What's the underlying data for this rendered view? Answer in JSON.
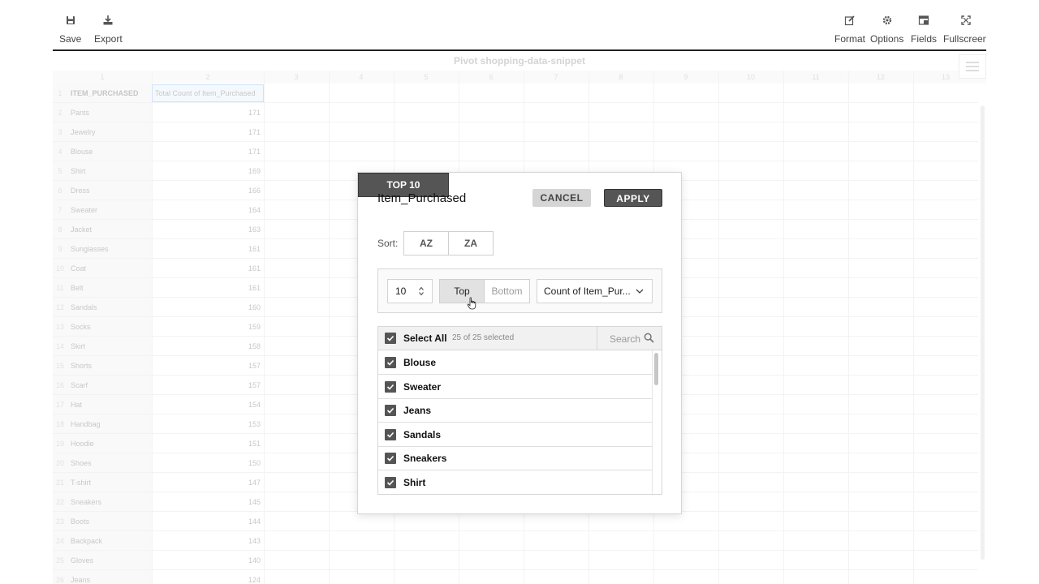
{
  "toolbar": {
    "save": "Save",
    "export": "Export",
    "format": "Format",
    "options": "Options",
    "fields": "Fields",
    "fullscreen": "Fullscreen"
  },
  "grid": {
    "title": "Pivot shopping-data-snippet",
    "column_numbers": [
      "1",
      "2",
      "3",
      "4",
      "5",
      "6",
      "7",
      "8",
      "9",
      "10",
      "11",
      "12",
      "13"
    ],
    "header_row_label": "ITEM_PURCHASED",
    "header_value_label": "Total Count of Item_Purchased",
    "rows": [
      {
        "num": "2",
        "label": "Pants",
        "value": "171"
      },
      {
        "num": "3",
        "label": "Jewelry",
        "value": "171"
      },
      {
        "num": "4",
        "label": "Blouse",
        "value": "171"
      },
      {
        "num": "5",
        "label": "Shirt",
        "value": "169"
      },
      {
        "num": "6",
        "label": "Dress",
        "value": "166"
      },
      {
        "num": "7",
        "label": "Sweater",
        "value": "164"
      },
      {
        "num": "8",
        "label": "Jacket",
        "value": "163"
      },
      {
        "num": "9",
        "label": "Sunglasses",
        "value": "161"
      },
      {
        "num": "10",
        "label": "Coat",
        "value": "161"
      },
      {
        "num": "11",
        "label": "Belt",
        "value": "161"
      },
      {
        "num": "12",
        "label": "Sandals",
        "value": "160"
      },
      {
        "num": "13",
        "label": "Socks",
        "value": "159"
      },
      {
        "num": "14",
        "label": "Skirt",
        "value": "158"
      },
      {
        "num": "15",
        "label": "Shorts",
        "value": "157"
      },
      {
        "num": "16",
        "label": "Scarf",
        "value": "157"
      },
      {
        "num": "17",
        "label": "Hat",
        "value": "154"
      },
      {
        "num": "18",
        "label": "Handbag",
        "value": "153"
      },
      {
        "num": "19",
        "label": "Hoodie",
        "value": "151"
      },
      {
        "num": "20",
        "label": "Shoes",
        "value": "150"
      },
      {
        "num": "21",
        "label": "T-shirt",
        "value": "147"
      },
      {
        "num": "22",
        "label": "Sneakers",
        "value": "145"
      },
      {
        "num": "23",
        "label": "Boots",
        "value": "144"
      },
      {
        "num": "24",
        "label": "Backpack",
        "value": "143"
      },
      {
        "num": "25",
        "label": "Gloves",
        "value": "140"
      },
      {
        "num": "26",
        "label": "Jeans",
        "value": "124"
      }
    ]
  },
  "dialog": {
    "title": "Item_Purchased",
    "cancel": "CANCEL",
    "apply": "APPLY",
    "sort_label": "Sort:",
    "sort_az": "AZ",
    "sort_za": "ZA",
    "top10": "TOP 10",
    "count_value": "10",
    "top": "Top",
    "bottom": "Bottom",
    "measure": "Count of Item_Pur...",
    "select_all": "Select All",
    "selected_count": "25 of 25 selected",
    "search_placeholder": "Search",
    "items": [
      "Blouse",
      "Sweater",
      "Jeans",
      "Sandals",
      "Sneakers",
      "Shirt"
    ]
  }
}
